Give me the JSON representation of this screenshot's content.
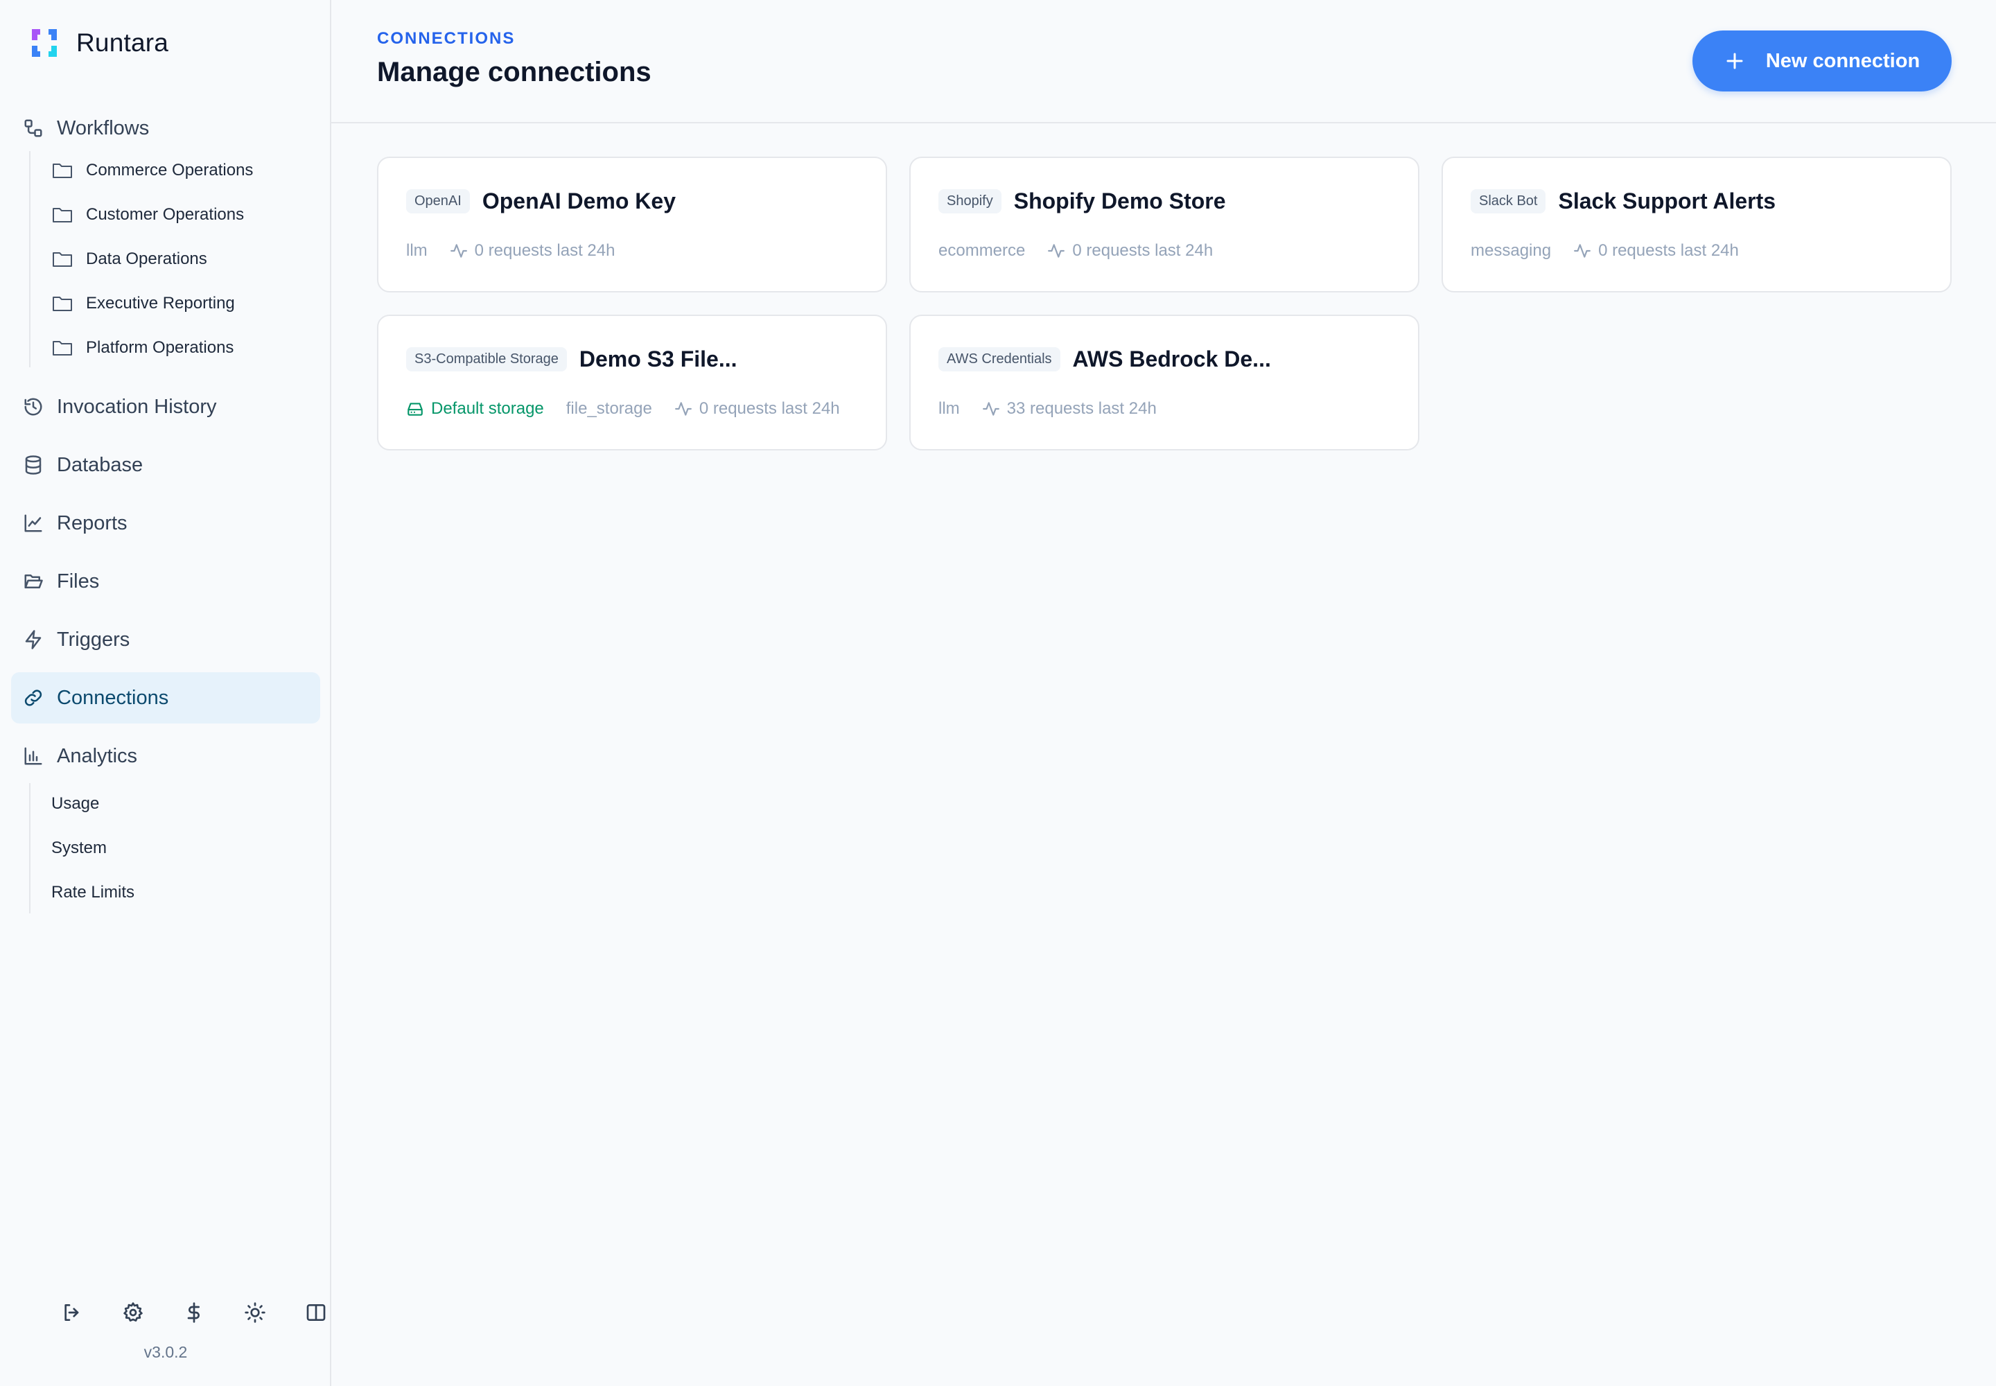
{
  "brand": {
    "name": "Runtara"
  },
  "sidebar": {
    "workflows": {
      "label": "Workflows",
      "folders": [
        {
          "label": "Commerce Operations"
        },
        {
          "label": "Customer Operations"
        },
        {
          "label": "Data Operations"
        },
        {
          "label": "Executive Reporting"
        },
        {
          "label": "Platform Operations"
        }
      ]
    },
    "items": [
      {
        "label": "Invocation History",
        "icon": "history-icon"
      },
      {
        "label": "Database",
        "icon": "database-icon"
      },
      {
        "label": "Reports",
        "icon": "chart-line-icon"
      },
      {
        "label": "Files",
        "icon": "folder-open-icon"
      },
      {
        "label": "Triggers",
        "icon": "lightning-icon"
      },
      {
        "label": "Connections",
        "icon": "link-icon",
        "active": true
      },
      {
        "label": "Analytics",
        "icon": "bar-chart-icon"
      }
    ],
    "analytics_sub": [
      {
        "label": "Usage"
      },
      {
        "label": "System"
      },
      {
        "label": "Rate Limits"
      }
    ],
    "footer_icons": [
      "logout-icon",
      "settings-icon",
      "dollar-icon",
      "sun-icon",
      "panel-icon"
    ],
    "version": "v3.0.2"
  },
  "header": {
    "eyebrow": "CONNECTIONS",
    "title": "Manage connections",
    "new_button": "New connection"
  },
  "cards": [
    {
      "badge": "OpenAI",
      "title": "OpenAI Demo Key",
      "category": "llm",
      "requests": "0 requests last 24h"
    },
    {
      "badge": "Shopify",
      "title": "Shopify Demo Store",
      "category": "ecommerce",
      "requests": "0 requests last 24h"
    },
    {
      "badge": "Slack Bot",
      "title": "Slack Support Alerts",
      "category": "messaging",
      "requests": "0 requests last 24h"
    },
    {
      "badge": "S3-Compatible Storage",
      "title": "Demo S3 File...",
      "default_label": "Default storage",
      "category": "file_storage",
      "requests": "0 requests last 24h"
    },
    {
      "badge": "AWS Credentials",
      "title": "AWS Bedrock De...",
      "category": "llm",
      "requests": "33 requests last 24h"
    }
  ],
  "colors": {
    "accent": "#3b82f6",
    "active_bg": "#e6f2fb",
    "eyebrow": "#2563eb",
    "success": "#059669"
  }
}
